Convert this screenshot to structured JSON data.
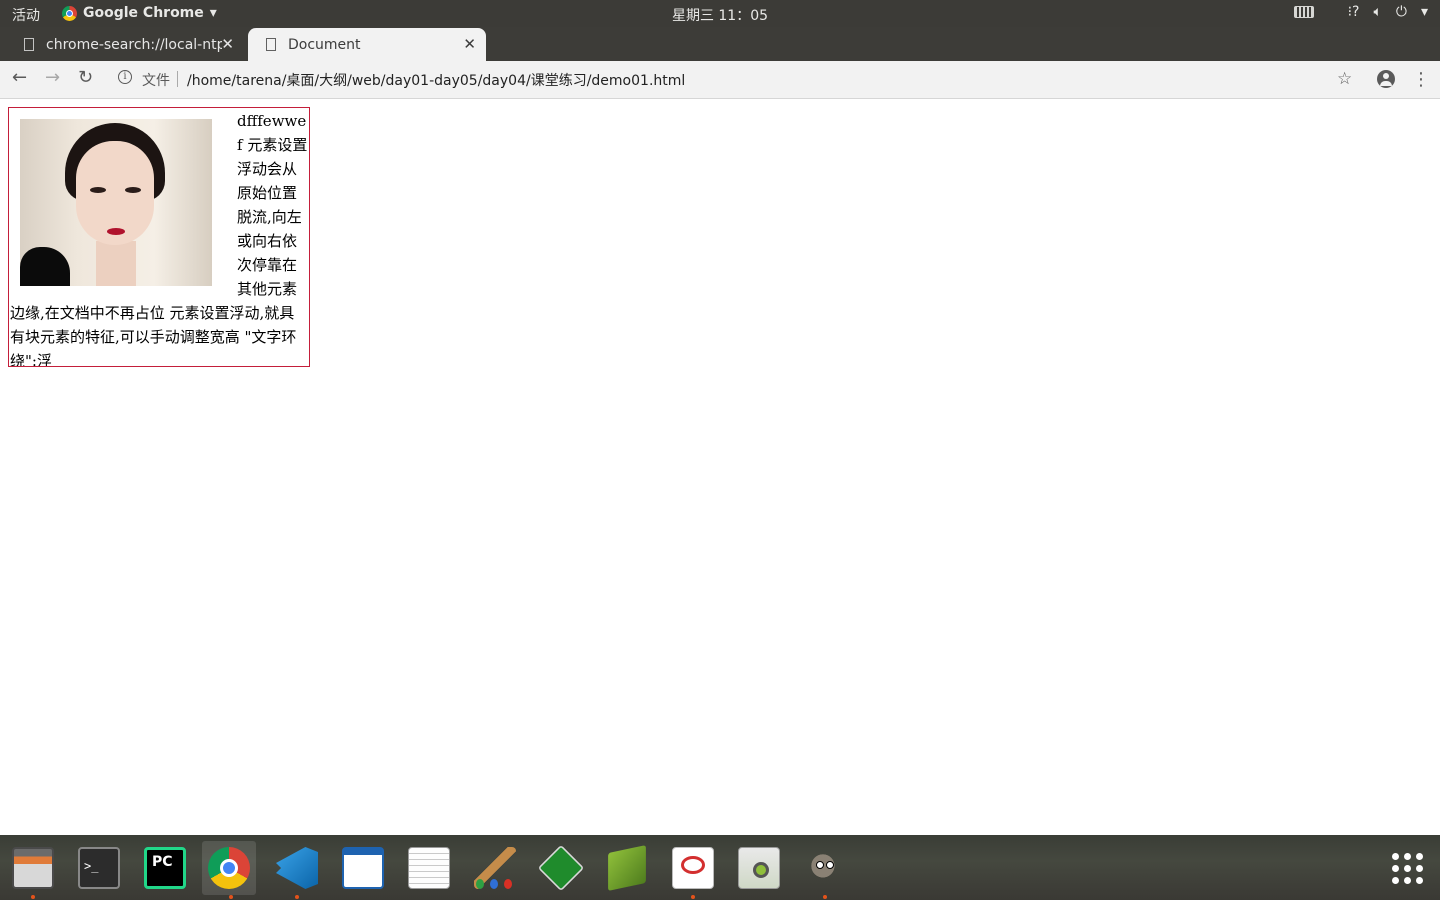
{
  "topbar": {
    "activities": "活动",
    "app_name": "Google Chrome",
    "clock": "星期三 11：05"
  },
  "tabs": [
    {
      "title": "chrome-search://local-ntp",
      "active": false
    },
    {
      "title": "Document",
      "active": true
    }
  ],
  "toolbar": {
    "security_label": "文件",
    "url": "/home/tarena/桌面/大纲/web/day01-day05/day04/课堂练习/demo01.html"
  },
  "page": {
    "text": "dfffewwef 元素设置浮动会从原始位置脱流,向左或向右依次停靠在其他元素边缘,在文档中不再占位 元素设置浮动,就具有块元素的特征,可以手动调整宽高 \"文字环绕\":浮",
    "box_border_color": "#c41e3a"
  },
  "dock": {
    "apps": [
      {
        "name": "files-icon",
        "running": true
      },
      {
        "name": "terminal-icon",
        "running": false
      },
      {
        "name": "pycharm-icon",
        "running": false
      },
      {
        "name": "chrome-icon",
        "running": true
      },
      {
        "name": "vscode-icon",
        "running": true
      },
      {
        "name": "writer-icon",
        "running": false
      },
      {
        "name": "text-editor-icon",
        "running": false
      },
      {
        "name": "paint-icon",
        "running": false
      },
      {
        "name": "vim-icon",
        "running": false
      },
      {
        "name": "book-icon",
        "running": false
      },
      {
        "name": "pdf-reader-icon",
        "running": true
      },
      {
        "name": "image-viewer-icon",
        "running": false
      },
      {
        "name": "gimp-icon",
        "running": true
      }
    ]
  }
}
